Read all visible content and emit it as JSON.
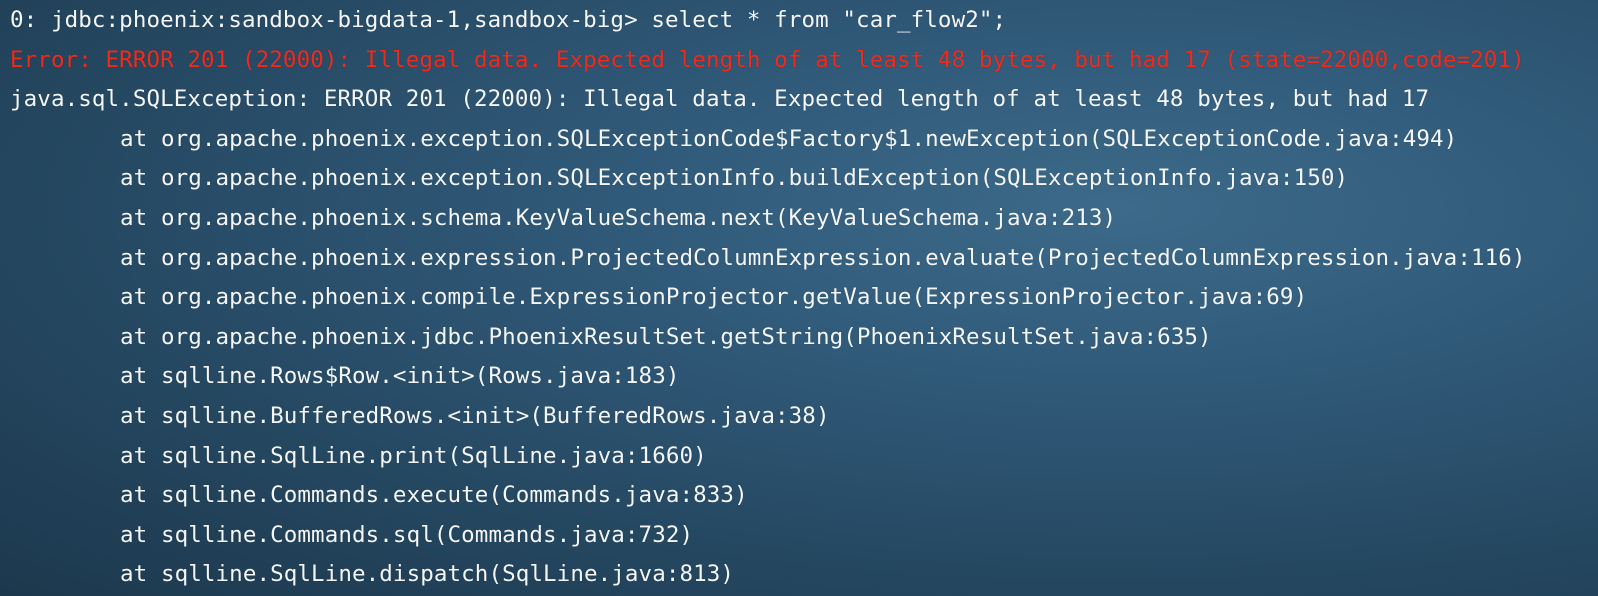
{
  "terminal": {
    "prompt_line": "0: jdbc:phoenix:sandbox-bigdata-1,sandbox-big> select * from \"car_flow2\";",
    "error_line": "Error: ERROR 201 (22000): Illegal data. Expected length of at least 48 bytes, but had 17 (state=22000,code=201)",
    "exception_line": "java.sql.SQLException: ERROR 201 (22000): Illegal data. Expected length of at least 48 bytes, but had 17",
    "stack": [
      "at org.apache.phoenix.exception.SQLExceptionCode$Factory$1.newException(SQLExceptionCode.java:494)",
      "at org.apache.phoenix.exception.SQLExceptionInfo.buildException(SQLExceptionInfo.java:150)",
      "at org.apache.phoenix.schema.KeyValueSchema.next(KeyValueSchema.java:213)",
      "at org.apache.phoenix.expression.ProjectedColumnExpression.evaluate(ProjectedColumnExpression.java:116)",
      "at org.apache.phoenix.compile.ExpressionProjector.getValue(ExpressionProjector.java:69)",
      "at org.apache.phoenix.jdbc.PhoenixResultSet.getString(PhoenixResultSet.java:635)",
      "at sqlline.Rows$Row.<init>(Rows.java:183)",
      "at sqlline.BufferedRows.<init>(BufferedRows.java:38)",
      "at sqlline.SqlLine.print(SqlLine.java:1660)",
      "at sqlline.Commands.execute(Commands.java:833)",
      "at sqlline.Commands.sql(Commands.java:732)",
      "at sqlline.SqlLine.dispatch(SqlLine.java:813)"
    ],
    "colors": {
      "text": "#f4f6f8",
      "error": "#ef2b1c",
      "background": "#2f5877"
    }
  }
}
